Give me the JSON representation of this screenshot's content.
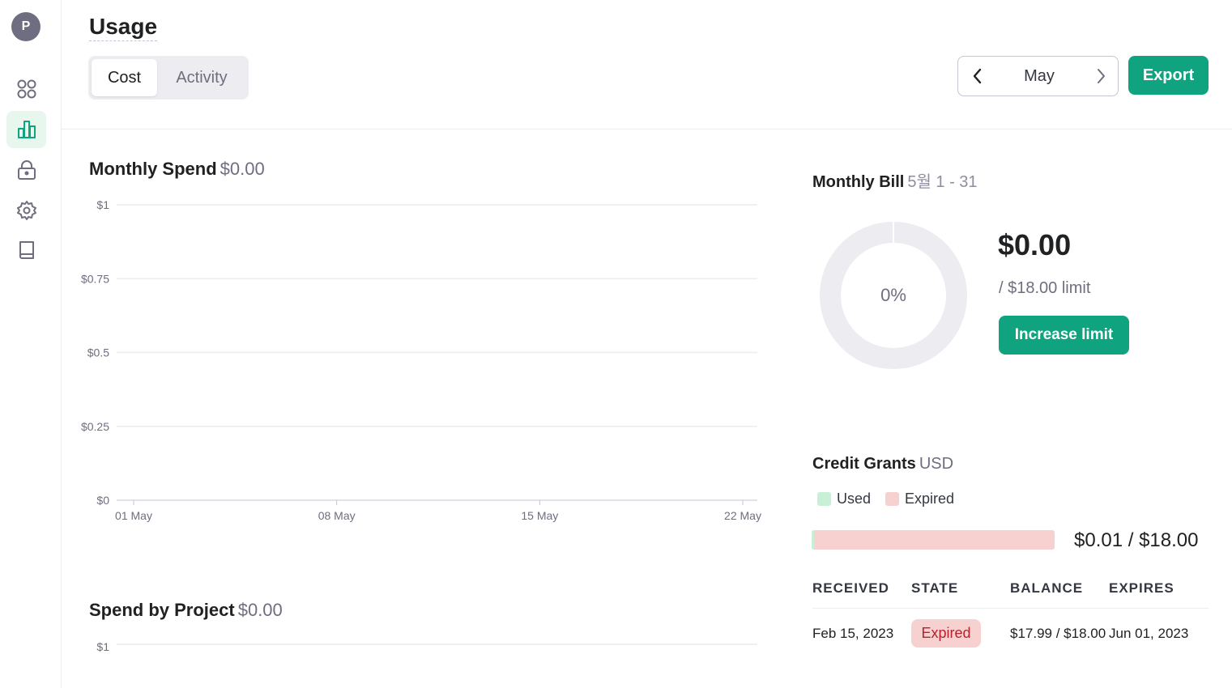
{
  "sidebar": {
    "avatar_initial": "P",
    "items": [
      {
        "icon": "grid-icon"
      },
      {
        "icon": "bar-chart-icon",
        "active": true
      },
      {
        "icon": "lock-icon"
      },
      {
        "icon": "gear-icon"
      },
      {
        "icon": "book-icon"
      }
    ]
  },
  "header": {
    "title": "Usage",
    "tabs": [
      {
        "label": "Cost",
        "active": true
      },
      {
        "label": "Activity",
        "active": false
      }
    ],
    "month": "May",
    "export_label": "Export"
  },
  "monthly_spend": {
    "title": "Monthly Spend",
    "total": "$0.00"
  },
  "spend_by_project": {
    "title": "Spend by Project",
    "total": "$0.00",
    "first_tick": "$1"
  },
  "chart_data": [
    {
      "type": "bar",
      "title": "Monthly Spend",
      "y_ticks": [
        "$1",
        "$0.75",
        "$0.5",
        "$0.25",
        "$0"
      ],
      "ylim": [
        0,
        1
      ],
      "x_ticks": [
        "01 May",
        "08 May",
        "15 May",
        "22 May"
      ],
      "values": [],
      "grid": true
    }
  ],
  "monthly_bill": {
    "title": "Monthly Bill",
    "period": "5월 1 - 31",
    "percent_label": "0%",
    "percent": 0,
    "amount": "$0.00",
    "limit": "/ $18.00 limit",
    "increase_label": "Increase limit"
  },
  "credit_grants": {
    "title": "Credit Grants",
    "currency": "USD",
    "legend": [
      {
        "label": "Used",
        "color": "#c8f0d7"
      },
      {
        "label": "Expired",
        "color": "#f7d0d0"
      }
    ],
    "used_fraction": 0.01,
    "total": "$0.01 / $18.00",
    "columns": [
      "RECEIVED",
      "STATE",
      "BALANCE",
      "EXPIRES"
    ],
    "rows": [
      {
        "received": "Feb 15, 2023",
        "state": "Expired",
        "balance": "$17.99 / $18.00",
        "expires": "Jun 01, 2023"
      }
    ]
  },
  "colors": {
    "accent": "#10a37f",
    "expired": "#f7d0d0",
    "used": "#c8f0d7"
  }
}
